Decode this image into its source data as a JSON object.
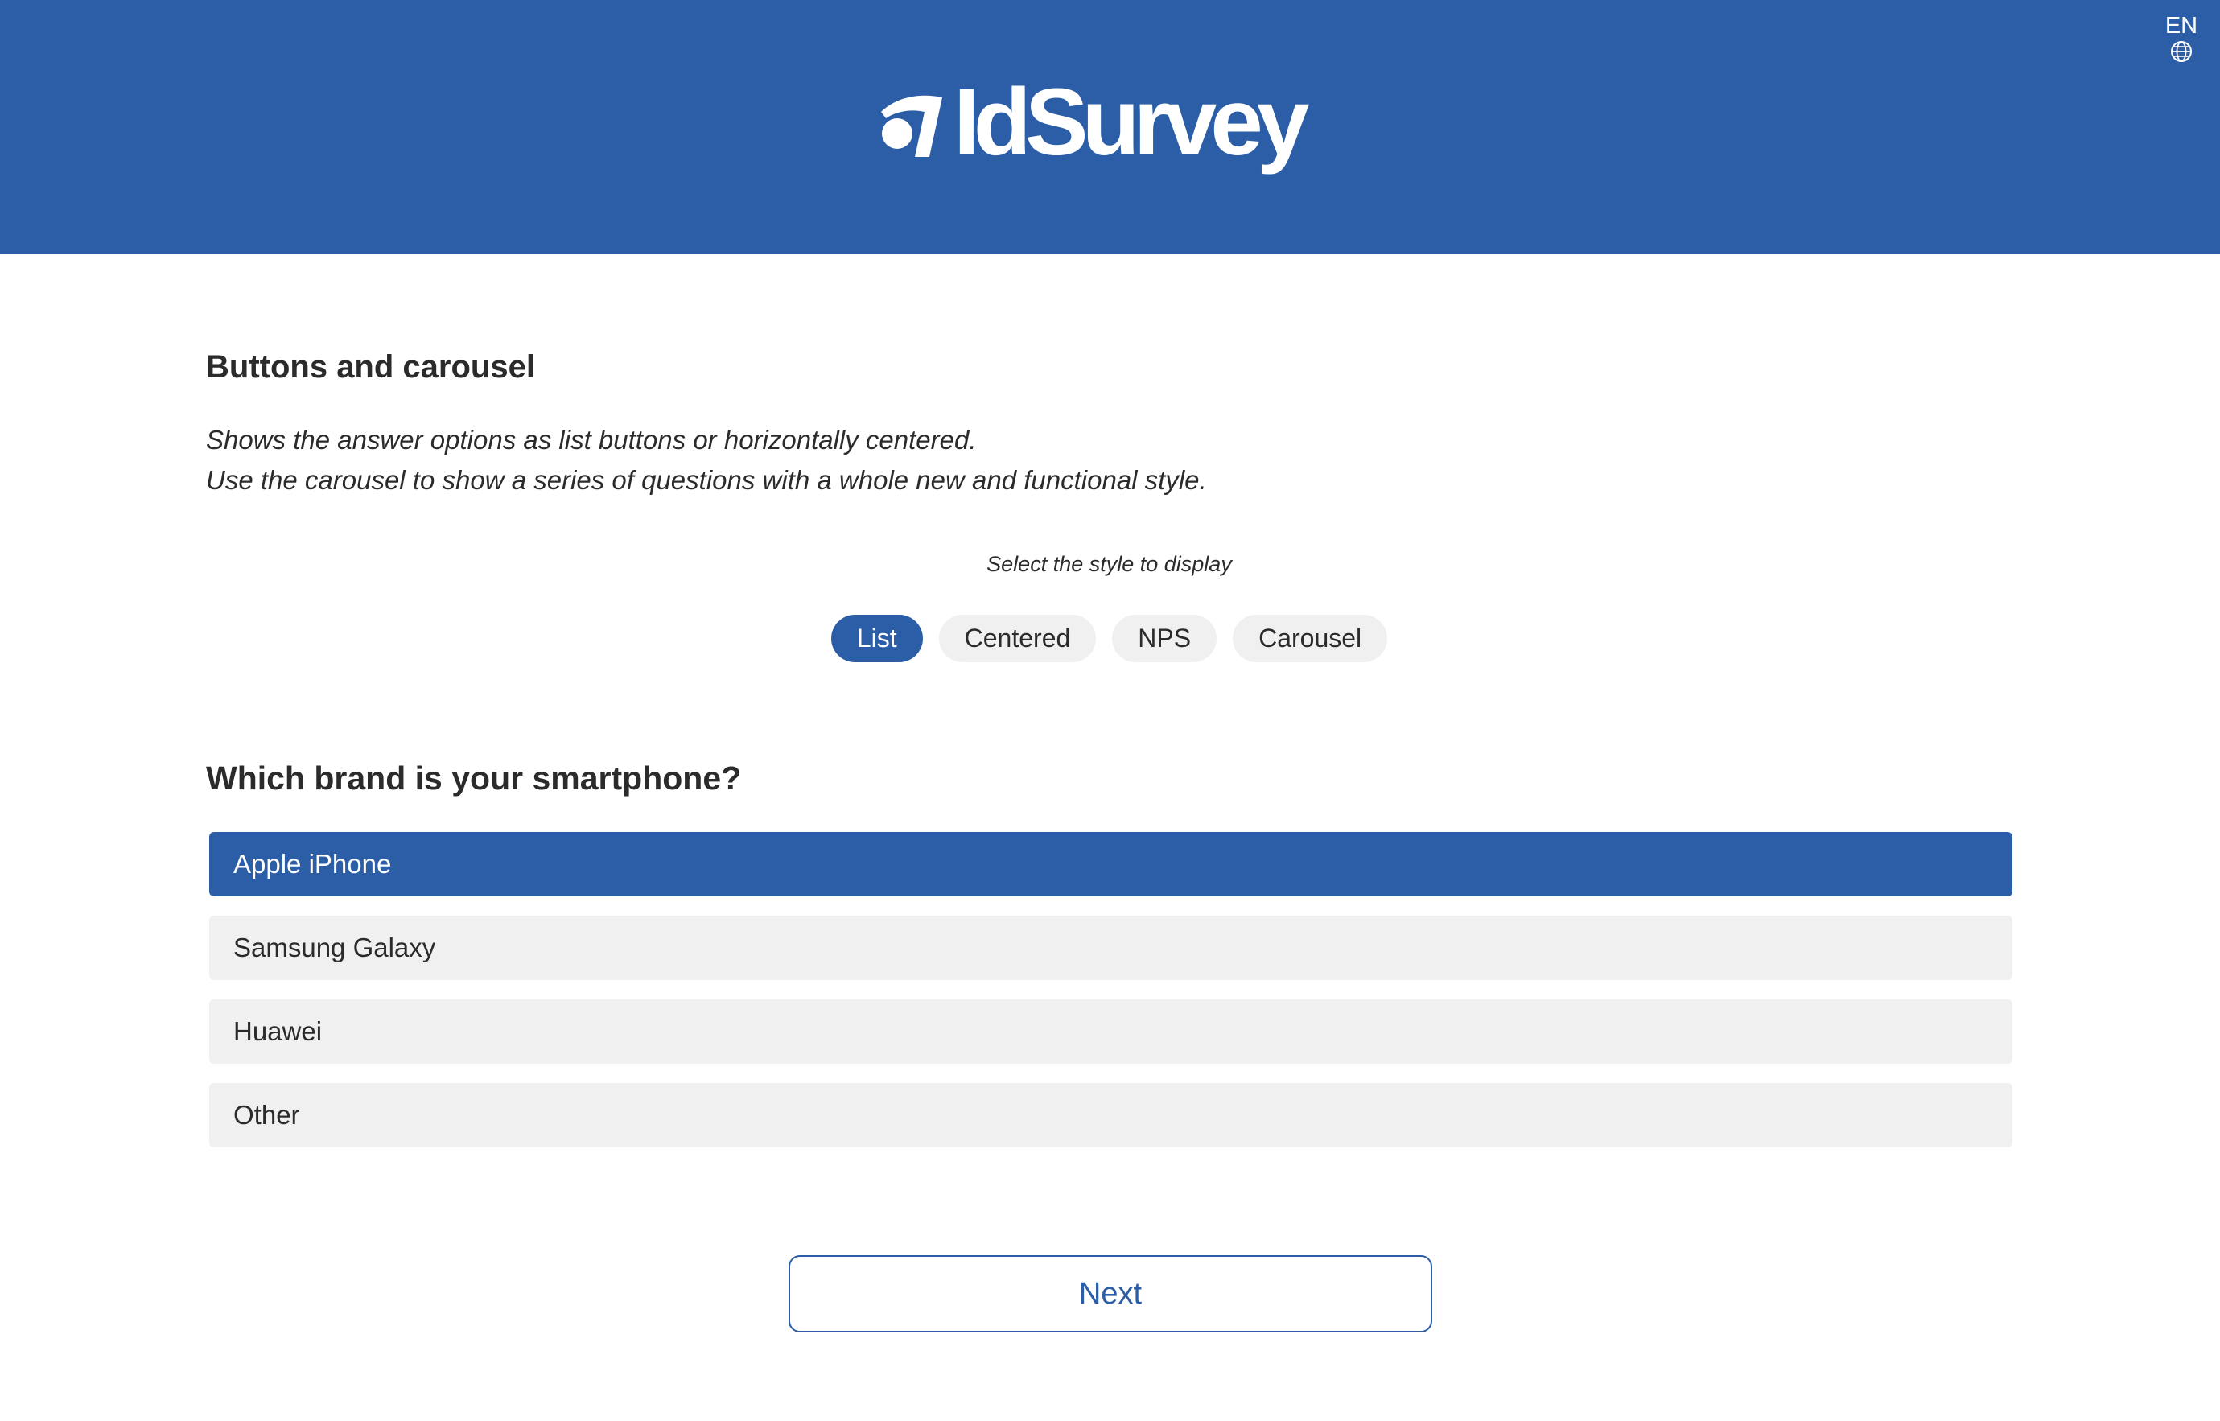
{
  "header": {
    "logo_text": "IdSurvey",
    "language_code": "EN",
    "language_icon": "globe-icon",
    "brand_color": "#2b5ea7"
  },
  "section": {
    "title": "Buttons and carousel",
    "description_lines": [
      "Shows the answer options as list buttons or horizontally centered.",
      "Use the carousel to show a series of questions with a whole new and functional style."
    ]
  },
  "style_selector": {
    "label": "Select the style to display",
    "options": [
      "List",
      "Centered",
      "NPS",
      "Carousel"
    ],
    "selected": "List"
  },
  "question": {
    "text": "Which brand is your smartphone?",
    "answers": [
      "Apple iPhone",
      "Samsung Galaxy",
      "Huawei",
      "Other"
    ],
    "selected": "Apple iPhone"
  },
  "navigation": {
    "next_label": "Next"
  }
}
